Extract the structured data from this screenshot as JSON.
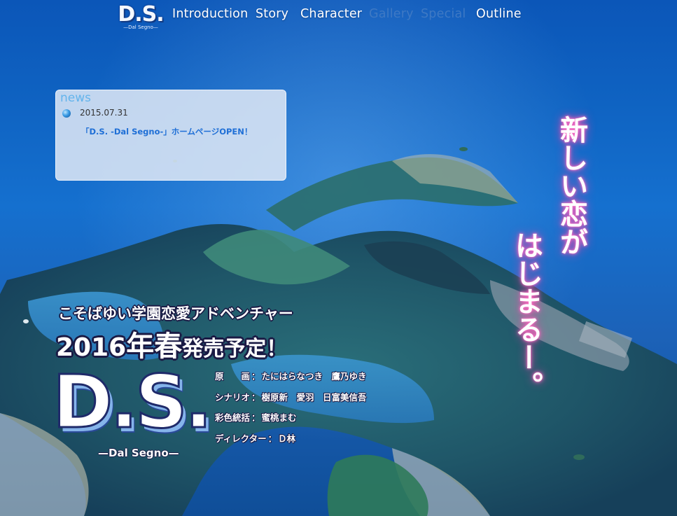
{
  "colors": {
    "ocean": "#1570cf",
    "nav_text": "#ffffff",
    "nav_disabled": "#3e79c4",
    "news_bg": "#dce6f5",
    "news_title": "#63b4ec",
    "news_link": "#1f6fd6",
    "catch_glow": "#ff3aa8"
  },
  "nav": {
    "logo_main": "D.S.",
    "logo_sub": "—Dal Segno—",
    "items": [
      {
        "label": "Introduction",
        "enabled": true
      },
      {
        "label": "Story",
        "enabled": true
      },
      {
        "label": "Character",
        "enabled": true
      },
      {
        "label": "Gallery",
        "enabled": false
      },
      {
        "label": "Special",
        "enabled": false
      },
      {
        "label": "Outline",
        "enabled": true
      }
    ]
  },
  "news": {
    "title": "news",
    "icon": "blue-orb-icon",
    "entries": [
      {
        "date": "2015.07.31",
        "text": "「D.S. -Dal Segno-」ホームページOPEN！"
      }
    ]
  },
  "catch_copy": {
    "line1": "新しい恋が",
    "line2": "はじまるー。"
  },
  "tagline": {
    "genre": "こそばゆい学園恋愛アドベンチャー",
    "release_year": "2016",
    "release_season": "年春",
    "release_rest": "発売予定！"
  },
  "title_logo": {
    "main": "D.S.",
    "sub": "—Dal Segno—"
  },
  "credits": [
    {
      "role": "原　　画",
      "names": "たにはらなつき　鷹乃ゆき"
    },
    {
      "role": "シナリオ",
      "names": "樹原新　愛羽　日富美信吾"
    },
    {
      "role": "彩色統括",
      "names": "蜜桃まむ"
    },
    {
      "role": "ディレクター",
      "names": "Ｄ林"
    }
  ]
}
